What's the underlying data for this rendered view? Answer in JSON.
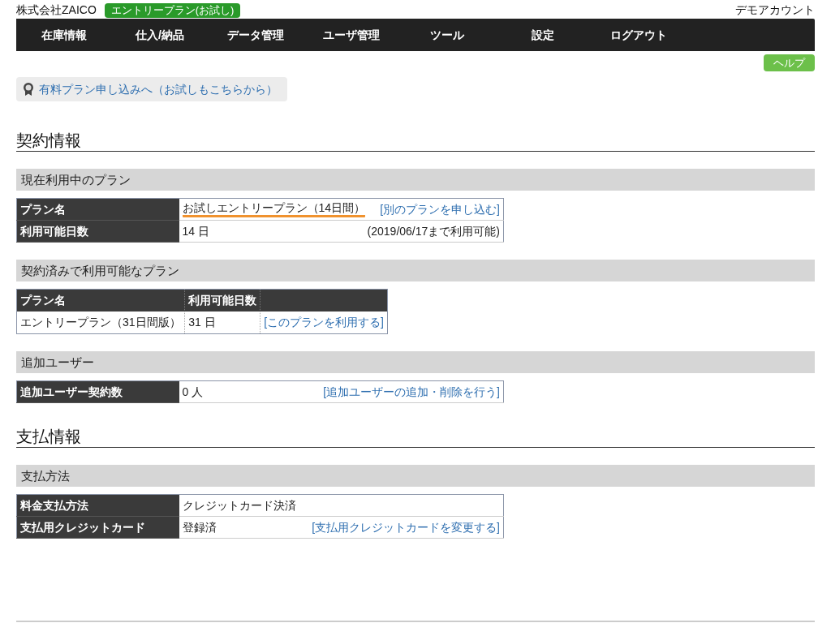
{
  "header": {
    "company": "株式会社ZAICO",
    "plan_badge": "エントリープラン(お試し)",
    "account": "デモアカウント"
  },
  "nav": {
    "items": [
      "在庫情報",
      "仕入/納品",
      "データ管理",
      "ユーザ管理",
      "ツール",
      "設定",
      "ログアウト"
    ]
  },
  "help_button": "ヘルプ",
  "upgrade_link": "有料プラン申し込みへ（お試しもこちらから）",
  "sections": [
    {
      "title": "契約情報",
      "subsections": [
        {
          "title": "現在利用中のプラン",
          "table": {
            "kind": "kv",
            "rows": [
              {
                "label": "プラン名",
                "value": "お試しエントリープラン（14日間）",
                "highlighted": true,
                "action": "[別のプランを申し込む]"
              },
              {
                "label": "利用可能日数",
                "value": "14 日",
                "highlighted": false,
                "note": "(2019/06/17まで利用可能)"
              }
            ]
          }
        },
        {
          "title": "契約済みで利用可能なプラン",
          "table": {
            "kind": "grid",
            "columns": [
              "プラン名",
              "利用可能日数"
            ],
            "rows": [
              {
                "cells": [
                  "エントリープラン（31日間版）",
                  "31 日"
                ],
                "action": "[このプランを利用する]"
              }
            ]
          }
        },
        {
          "title": "追加ユーザー",
          "table": {
            "kind": "kv",
            "rows": [
              {
                "label": "追加ユーザー契約数",
                "value": "0 人",
                "highlighted": false,
                "action": "[追加ユーザーの追加・削除を行う]"
              }
            ]
          }
        }
      ]
    },
    {
      "title": "支払情報",
      "subsections": [
        {
          "title": "支払方法",
          "table": {
            "kind": "kv",
            "rows": [
              {
                "label": "料金支払方法",
                "value": "クレジットカード決済",
                "highlighted": false
              },
              {
                "label": "支払用クレジットカード",
                "value": "登録済",
                "highlighted": false,
                "action": "[支払用クレジットカードを変更する]"
              }
            ]
          }
        }
      ]
    }
  ]
}
